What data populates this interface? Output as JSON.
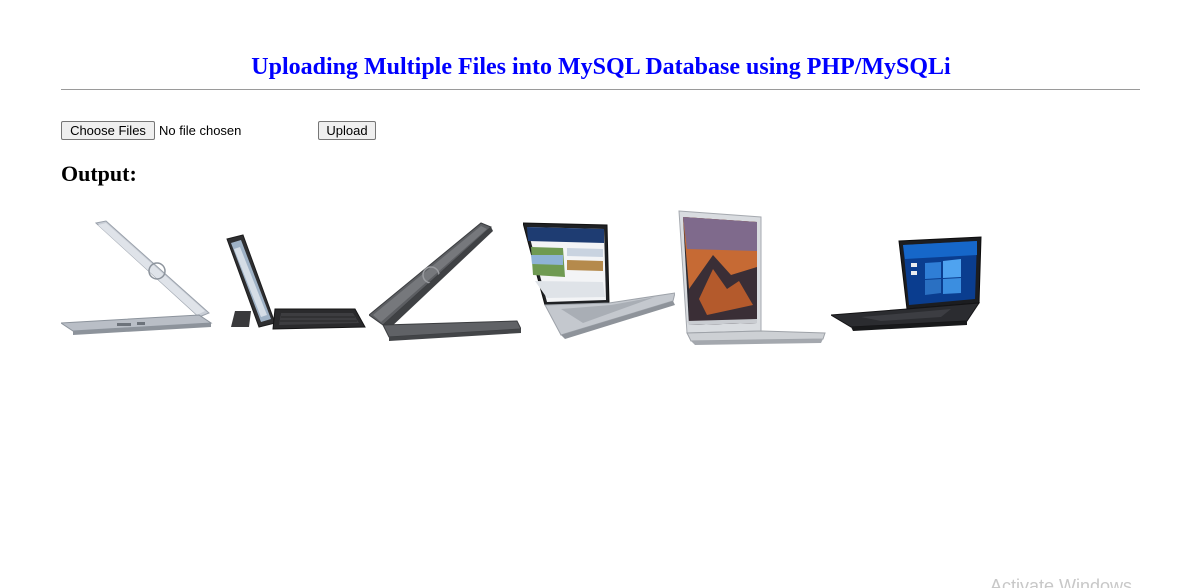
{
  "header": {
    "title": "Uploading Multiple Files into MySQL Database using PHP/MySQLi",
    "title_color": "#0000ff"
  },
  "form": {
    "choose_label": "Choose Files",
    "file_status": "No file chosen",
    "upload_label": "Upload"
  },
  "output": {
    "heading": "Output:",
    "images": [
      {
        "name": "laptop-silver-dell-rear"
      },
      {
        "name": "laptop-2in1-tablet-keyboard"
      },
      {
        "name": "laptop-dark-dell-rear"
      },
      {
        "name": "laptop-silver-city-bulletin"
      },
      {
        "name": "laptop-macbook-air"
      },
      {
        "name": "laptop-black-windows"
      }
    ]
  },
  "watermark": {
    "text": "Activate Windows"
  }
}
